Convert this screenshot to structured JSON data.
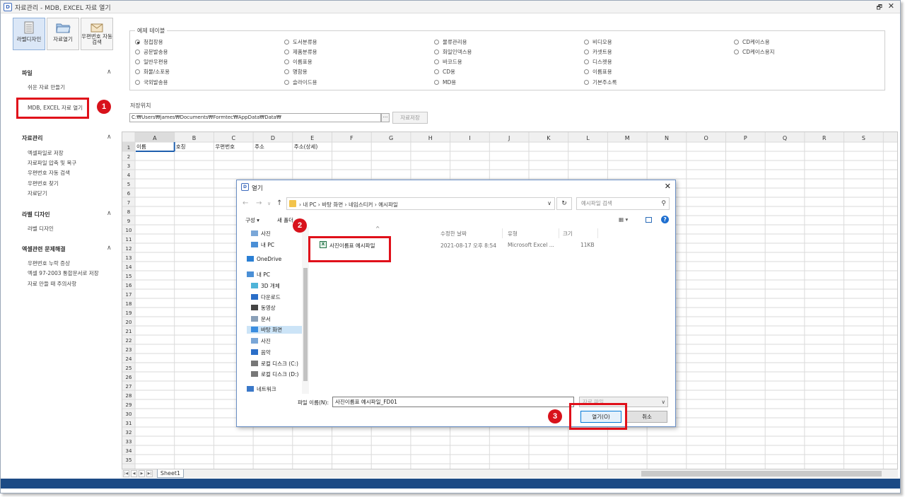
{
  "window": {
    "title": "자료관리 - MDB, EXCEL 자료 열기",
    "restore_glyph": "🗗",
    "close_glyph": "✕"
  },
  "toolbar": [
    {
      "label": "라벨디자인",
      "icon": "label-grid-icon",
      "active": true
    },
    {
      "label": "자료열기",
      "icon": "folder-open-icon",
      "active": false
    },
    {
      "label": "우편번호 자동검색",
      "icon": "envelope-icon",
      "active": false
    }
  ],
  "sidebar": {
    "sections": [
      {
        "title": "파일",
        "items": [
          "쉬운 자료 만들기",
          "MDB, EXCEL 자료 열기"
        ]
      },
      {
        "title": "자료관리",
        "items": [
          "엑셀파일로 저장",
          "자료파일 압축 및 복구",
          "우편번호 자동 검색",
          "우편번호 찾기",
          "자료닫기"
        ]
      },
      {
        "title": "라벨 디자인",
        "items": [
          "라벨 디자인"
        ]
      },
      {
        "title": "엑셀관련 문제해결",
        "items": [
          "우편번호 누락 증상",
          "엑셀 97-2003 통합문서로 저장",
          "자료 만들 때 주의사항"
        ]
      }
    ],
    "collapse_glyph": "∧"
  },
  "example_tables": {
    "legend": "예제 테이블",
    "selected": "청첩장용",
    "columns": [
      [
        "청첩장용",
        "공문발송용",
        "일반우편용",
        "화물/소포용",
        "국외발송용"
      ],
      [
        "도서분류용",
        "제품분류용",
        "이름표용",
        "명함용",
        "슬라이드용"
      ],
      [
        "물류관리용",
        "화일인덱스용",
        "바코드용",
        "CD용",
        "MD용"
      ],
      [
        "비디오용",
        "카셋트용",
        "디스켓용",
        "이름표용",
        "기본주소록"
      ],
      [
        "CD케이스용",
        "CD케이스용지"
      ]
    ]
  },
  "save_location": {
    "label": "저장위치",
    "path": "C:₩Users₩james₩Documents₩Formtec₩AppData₩Data₩",
    "browse_label": "···",
    "save_button": "자료저장"
  },
  "spreadsheet": {
    "columns": [
      "A",
      "B",
      "C",
      "D",
      "E",
      "F",
      "G",
      "H",
      "I",
      "J",
      "K",
      "L",
      "M",
      "N",
      "O",
      "P",
      "Q",
      "R",
      "S"
    ],
    "row_count": 35,
    "header_row": [
      "이름",
      "호칭",
      "우편번호",
      "주소",
      "주소(상세)"
    ],
    "sheet_tab": "Sheet1"
  },
  "dialog": {
    "title": "열기",
    "close_glyph": "✕",
    "nav": {
      "back": "←",
      "forward": "→",
      "recent": "∨",
      "up": "↑"
    },
    "breadcrumb": "›  내 PC  ›  바탕 화면  ›  네임스티커  ›  예시파일",
    "refresh": "↻",
    "search_placeholder": "예시파일 검색",
    "search_glyph": "⚲",
    "organize": "구성 ▾",
    "new_folder": "새 폴더",
    "view_glyph": "▦ ▾",
    "help_glyph": "?",
    "nav_items": [
      {
        "label": "사진",
        "icon": "pictures-icon"
      },
      {
        "label": "내 PC",
        "icon": "pc-icon"
      },
      {
        "label": "OneDrive",
        "icon": "cloud-icon"
      },
      {
        "label": "내 PC",
        "icon": "pc-icon"
      },
      {
        "label": "3D 개체",
        "icon": "cube-icon"
      },
      {
        "label": "다운로드",
        "icon": "download-icon"
      },
      {
        "label": "동영상",
        "icon": "video-icon"
      },
      {
        "label": "문서",
        "icon": "document-icon"
      },
      {
        "label": "바탕 화면",
        "icon": "desktop-icon"
      },
      {
        "label": "사진",
        "icon": "pictures-icon"
      },
      {
        "label": "음악",
        "icon": "music-icon"
      },
      {
        "label": "로컬 디스크 (C:)",
        "icon": "drive-icon"
      },
      {
        "label": "로컬 디스크 (D:)",
        "icon": "drive-icon"
      },
      {
        "label": "네트워크",
        "icon": "network-icon"
      }
    ],
    "list_columns": {
      "name_sort": "^",
      "modified": "수정한 날짜",
      "type": "유형",
      "size": "크기"
    },
    "files": [
      {
        "name": "사진이름표 예시파일",
        "modified": "2021-08-17 오후 8:54",
        "type": "Microsoft Excel ...",
        "size": "11KB"
      }
    ],
    "filename_label": "파일 이름(N):",
    "filename_value": "사진이름표 예시파일_FD01",
    "filetype_value": "자료 파일",
    "open_button": "열기(O)",
    "cancel_button": "취소"
  },
  "callouts": [
    "1",
    "2",
    "3"
  ],
  "colors": {
    "accent": "#1c4a85",
    "callout": "#e0101a"
  }
}
